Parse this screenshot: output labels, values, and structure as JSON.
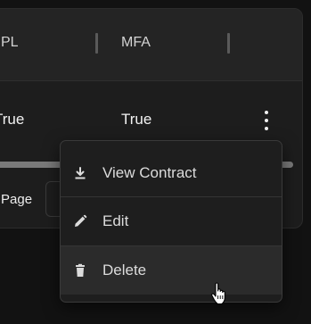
{
  "table": {
    "columns": [
      {
        "label": "PL"
      },
      {
        "label": "MFA"
      }
    ],
    "row": {
      "col1_value": "True",
      "col2_value": "True"
    },
    "actions_icon": "more-vert-icon"
  },
  "pagination": {
    "page_label": "Page",
    "page_value": ""
  },
  "context_menu": {
    "items": [
      {
        "label": "View Contract",
        "icon": "download-icon"
      },
      {
        "label": "Edit",
        "icon": "pencil-icon"
      },
      {
        "label": "Delete",
        "icon": "trash-icon"
      }
    ],
    "hovered_item": "Delete"
  },
  "colors": {
    "background": "#121212",
    "panel": "#1d1d1d",
    "header": "#242424",
    "menu": "#1e1e1e",
    "menu_hover": "#2b2b2b",
    "text": "#dcdcdc"
  }
}
